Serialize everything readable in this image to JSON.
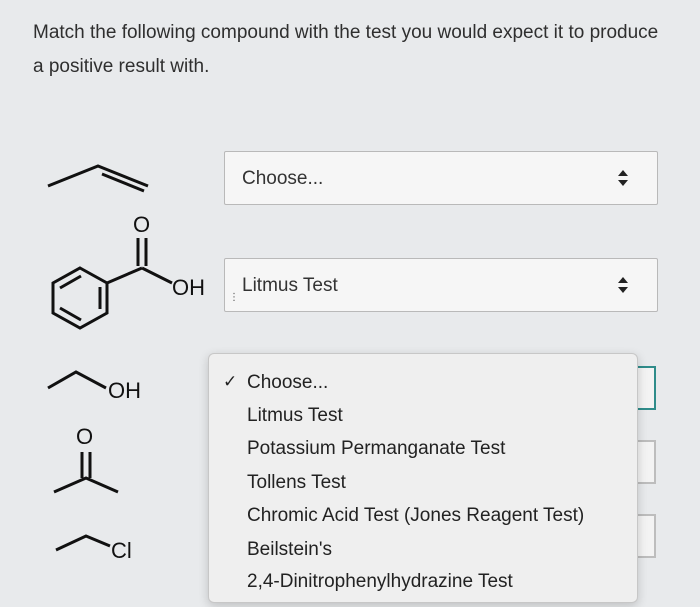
{
  "question": "Match the following compound with the test you would expect it to produce a positive result with.",
  "compound_labels": {
    "oh_benzoic": "OH",
    "oh_propanol": "OH",
    "o_benzoic": "O",
    "o_acetone": "O",
    "cl": "Cl"
  },
  "selects": [
    {
      "value": "Choose..."
    },
    {
      "value": "Litmus Test"
    }
  ],
  "dropdown": {
    "checkmark": "✓",
    "options": [
      "Choose...",
      "Litmus Test",
      "Potassium Permanganate Test",
      "Tollens Test",
      "Chromic Acid Test (Jones Reagent Test)",
      "Beilstein's",
      "2,4-Dinitrophenylhydrazine Test"
    ]
  },
  "colors": {
    "background": "#e8eaec",
    "active_box": "#2f8c8a"
  }
}
